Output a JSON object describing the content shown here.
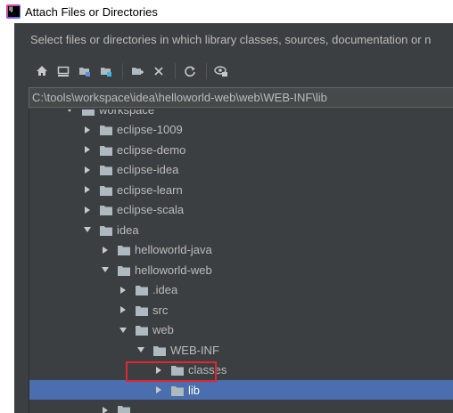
{
  "window": {
    "title": "Attach Files or Directories"
  },
  "dialog": {
    "description": "Select files or directories in which library classes, sources, documentation or n"
  },
  "toolbar": {
    "buttons": [
      "home-icon",
      "desktop-icon",
      "project-icon",
      "module-icon",
      "new-folder-icon",
      "delete-icon",
      "refresh-icon",
      "show-hidden-icon"
    ]
  },
  "path": {
    "value": "C:\\tools\\workspace\\idea\\helloworld-web\\web\\WEB-INF\\lib"
  },
  "tree": {
    "rows": [
      {
        "label": "workspace",
        "depth": 0,
        "expanded": true
      },
      {
        "label": "eclipse-1009",
        "depth": 1,
        "expanded": false
      },
      {
        "label": "eclipse-demo",
        "depth": 1,
        "expanded": false
      },
      {
        "label": "eclipse-idea",
        "depth": 1,
        "expanded": false
      },
      {
        "label": "eclipse-learn",
        "depth": 1,
        "expanded": false
      },
      {
        "label": "eclipse-scala",
        "depth": 1,
        "expanded": false
      },
      {
        "label": "idea",
        "depth": 1,
        "expanded": true
      },
      {
        "label": "helloworld-java",
        "depth": 2,
        "expanded": false
      },
      {
        "label": "helloworld-web",
        "depth": 2,
        "expanded": true
      },
      {
        "label": ".idea",
        "depth": 3,
        "expanded": false
      },
      {
        "label": "src",
        "depth": 3,
        "expanded": false
      },
      {
        "label": "web",
        "depth": 3,
        "expanded": true
      },
      {
        "label": "WEB-INF",
        "depth": 4,
        "expanded": true
      },
      {
        "label": "classes",
        "depth": 5,
        "expanded": false
      },
      {
        "label": "lib",
        "depth": 5,
        "expanded": false,
        "selected": true
      },
      {
        "label": "",
        "depth": 2,
        "expanded": false
      }
    ]
  },
  "colors": {
    "background": "#3c3f41",
    "selection": "#4b6eaf",
    "folder": "#aeb9c0",
    "highlight_box": "#e0262f"
  }
}
